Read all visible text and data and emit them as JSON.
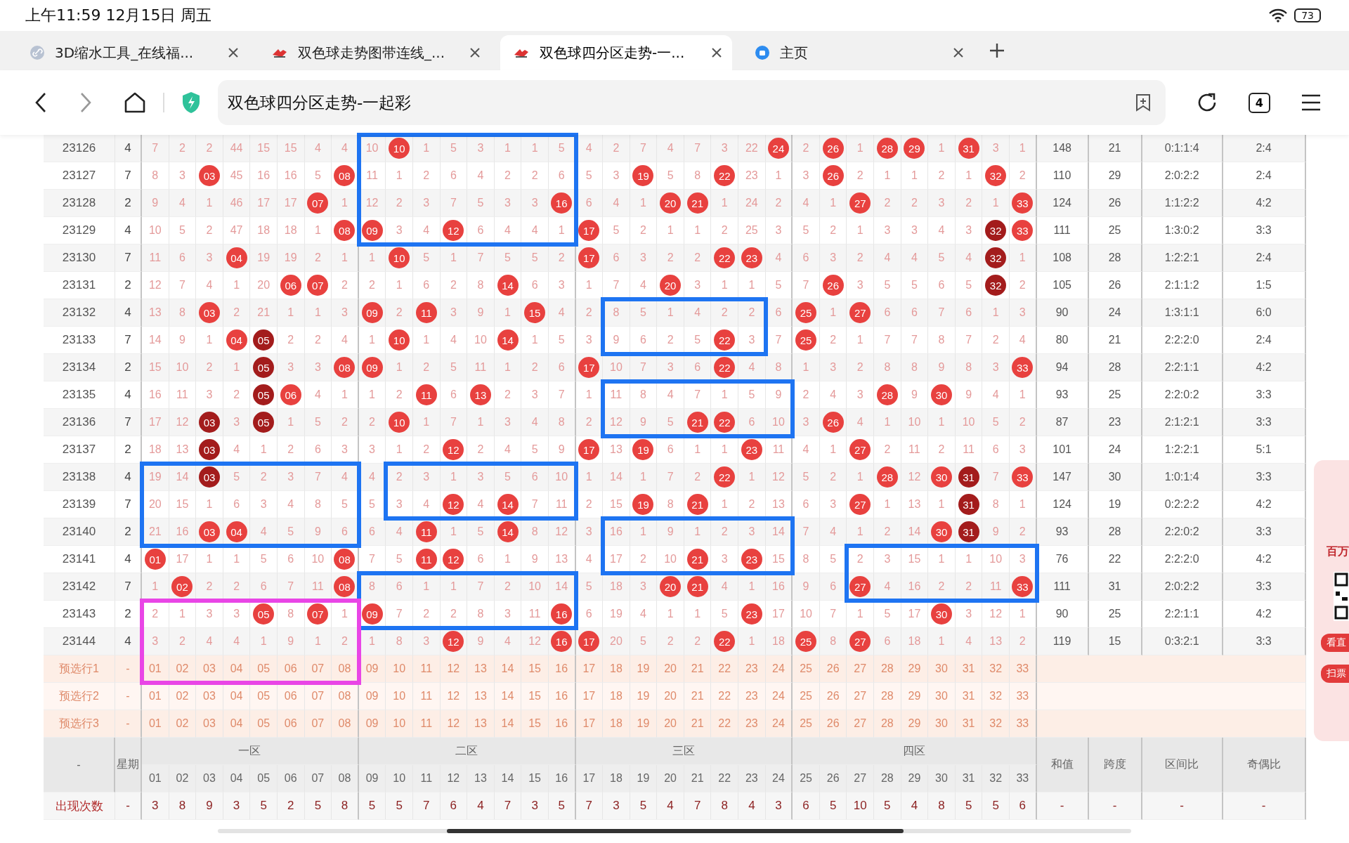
{
  "status_bar": {
    "time": "上午11:59 12月15日 周五",
    "battery": "73"
  },
  "tabs": [
    {
      "title": "3D缩水工具_在线福...",
      "kind": "link",
      "selected": false
    },
    {
      "title": "双色球走势图带连线_...",
      "kind": "site",
      "selected": false
    },
    {
      "title": "双色球四分区走势-一...",
      "kind": "site",
      "selected": true
    },
    {
      "title": "主页",
      "kind": "home",
      "selected": false
    }
  ],
  "address_bar": {
    "value": "双色球四分区走势-一起彩",
    "tab_count": "4"
  },
  "rows": [
    {
      "period": "23126",
      "weekday": "4",
      "cells": [
        "7",
        "2",
        "2",
        "44",
        "15",
        "15",
        "4",
        "4",
        "10",
        {
          "ball": "10",
          "kind": "red"
        },
        "1",
        "5",
        "3",
        "1",
        "1",
        "5",
        "4",
        "2",
        "7",
        "4",
        "7",
        "3",
        "22",
        {
          "ball": "24",
          "kind": "red"
        },
        "2",
        {
          "ball": "26",
          "kind": "red"
        },
        "1",
        {
          "ball": "28",
          "kind": "red"
        },
        {
          "ball": "29",
          "kind": "red"
        },
        "1",
        {
          "ball": "31",
          "kind": "red"
        },
        "3",
        "1"
      ],
      "sum": "148",
      "span": "21",
      "zone_ratio": "0:1:1:4",
      "odd_even": "2:4"
    },
    {
      "period": "23127",
      "weekday": "7",
      "cells": [
        "8",
        "3",
        {
          "ball": "03",
          "kind": "red"
        },
        "45",
        "16",
        "16",
        "5",
        {
          "ball": "08",
          "kind": "red"
        },
        "11",
        "1",
        "2",
        "6",
        "4",
        "2",
        "2",
        "6",
        "5",
        "3",
        {
          "ball": "19",
          "kind": "red"
        },
        "5",
        "8",
        {
          "ball": "22",
          "kind": "red"
        },
        "23",
        "1",
        "3",
        {
          "ball": "26",
          "kind": "red"
        },
        "2",
        "1",
        "1",
        "2",
        "1",
        {
          "ball": "32",
          "kind": "red"
        },
        "2"
      ],
      "sum": "110",
      "span": "29",
      "zone_ratio": "2:0:2:2",
      "odd_even": "2:4"
    },
    {
      "period": "23128",
      "weekday": "2",
      "cells": [
        "9",
        "4",
        "1",
        "46",
        "17",
        "17",
        {
          "ball": "07",
          "kind": "red"
        },
        "1",
        "12",
        "2",
        "3",
        "7",
        "5",
        "3",
        "3",
        {
          "ball": "16",
          "kind": "red"
        },
        "6",
        "4",
        "1",
        {
          "ball": "20",
          "kind": "red"
        },
        {
          "ball": "21",
          "kind": "red"
        },
        "1",
        "24",
        "2",
        "4",
        "1",
        {
          "ball": "27",
          "kind": "red"
        },
        "2",
        "2",
        "3",
        "2",
        "1",
        {
          "ball": "33",
          "kind": "red"
        }
      ],
      "sum": "124",
      "span": "26",
      "zone_ratio": "1:1:2:2",
      "odd_even": "4:2"
    },
    {
      "period": "23129",
      "weekday": "4",
      "cells": [
        "10",
        "5",
        "2",
        "47",
        "18",
        "18",
        "1",
        {
          "ball": "08",
          "kind": "red"
        },
        {
          "ball": "09",
          "kind": "red"
        },
        "3",
        "4",
        {
          "ball": "12",
          "kind": "red"
        },
        "6",
        "4",
        "4",
        "1",
        {
          "ball": "17",
          "kind": "red"
        },
        "5",
        "2",
        "1",
        "1",
        "2",
        "25",
        "3",
        "5",
        "2",
        "1",
        "3",
        "3",
        "4",
        "3",
        {
          "ball": "32",
          "kind": "dark"
        },
        {
          "ball": "33",
          "kind": "red"
        }
      ],
      "sum": "111",
      "span": "25",
      "zone_ratio": "1:3:0:2",
      "odd_even": "3:3"
    },
    {
      "period": "23130",
      "weekday": "7",
      "cells": [
        "11",
        "6",
        "3",
        {
          "ball": "04",
          "kind": "red"
        },
        "19",
        "19",
        "2",
        "1",
        "1",
        {
          "ball": "10",
          "kind": "red"
        },
        "5",
        "1",
        "7",
        "5",
        "5",
        "2",
        {
          "ball": "17",
          "kind": "red"
        },
        "6",
        "3",
        "2",
        "2",
        {
          "ball": "22",
          "kind": "red"
        },
        {
          "ball": "23",
          "kind": "red"
        },
        "4",
        "6",
        "3",
        "2",
        "4",
        "4",
        "5",
        "4",
        {
          "ball": "32",
          "kind": "dark"
        },
        "1"
      ],
      "sum": "108",
      "span": "28",
      "zone_ratio": "1:2:2:1",
      "odd_even": "2:4"
    },
    {
      "period": "23131",
      "weekday": "2",
      "cells": [
        "12",
        "7",
        "4",
        "1",
        "20",
        {
          "ball": "06",
          "kind": "red"
        },
        {
          "ball": "07",
          "kind": "red"
        },
        "2",
        "2",
        "1",
        "6",
        "2",
        "8",
        {
          "ball": "14",
          "kind": "red"
        },
        "6",
        "3",
        "1",
        "7",
        "4",
        {
          "ball": "20",
          "kind": "red"
        },
        "3",
        "1",
        "1",
        "5",
        "7",
        {
          "ball": "26",
          "kind": "red"
        },
        "3",
        "5",
        "5",
        "6",
        "5",
        {
          "ball": "32",
          "kind": "dark"
        },
        "2"
      ],
      "sum": "105",
      "span": "26",
      "zone_ratio": "2:1:1:2",
      "odd_even": "1:5"
    },
    {
      "period": "23132",
      "weekday": "4",
      "cells": [
        "13",
        "8",
        {
          "ball": "03",
          "kind": "red"
        },
        "2",
        "21",
        "1",
        "1",
        "3",
        {
          "ball": "09",
          "kind": "red"
        },
        "2",
        {
          "ball": "11",
          "kind": "red"
        },
        "3",
        "9",
        "1",
        {
          "ball": "15",
          "kind": "red"
        },
        "4",
        "2",
        "8",
        "5",
        "1",
        "4",
        "2",
        "2",
        "6",
        {
          "ball": "25",
          "kind": "red"
        },
        "1",
        {
          "ball": "27",
          "kind": "red"
        },
        "6",
        "6",
        "7",
        "6",
        "1",
        "3"
      ],
      "sum": "90",
      "span": "24",
      "zone_ratio": "1:3:1:1",
      "odd_even": "6:0"
    },
    {
      "period": "23133",
      "weekday": "7",
      "cells": [
        "14",
        "9",
        "1",
        {
          "ball": "04",
          "kind": "red"
        },
        {
          "ball": "05",
          "kind": "dark"
        },
        "2",
        "2",
        "4",
        "1",
        {
          "ball": "10",
          "kind": "red"
        },
        "1",
        "4",
        "10",
        {
          "ball": "14",
          "kind": "red"
        },
        "1",
        "5",
        "3",
        "9",
        "6",
        "2",
        "5",
        {
          "ball": "22",
          "kind": "red"
        },
        "3",
        "7",
        {
          "ball": "25",
          "kind": "red"
        },
        "2",
        "1",
        "7",
        "7",
        "8",
        "7",
        "2",
        "4"
      ],
      "sum": "80",
      "span": "21",
      "zone_ratio": "2:2:2:0",
      "odd_even": "2:4"
    },
    {
      "period": "23134",
      "weekday": "2",
      "cells": [
        "15",
        "10",
        "2",
        "1",
        {
          "ball": "05",
          "kind": "dark"
        },
        "3",
        "3",
        {
          "ball": "08",
          "kind": "red"
        },
        {
          "ball": "09",
          "kind": "red"
        },
        "1",
        "2",
        "5",
        "11",
        "1",
        "2",
        "6",
        {
          "ball": "17",
          "kind": "red"
        },
        "10",
        "7",
        "3",
        "6",
        {
          "ball": "22",
          "kind": "red"
        },
        "4",
        "8",
        "1",
        "3",
        "2",
        "8",
        "8",
        "9",
        "8",
        "3",
        {
          "ball": "33",
          "kind": "red"
        }
      ],
      "sum": "94",
      "span": "28",
      "zone_ratio": "2:2:1:1",
      "odd_even": "4:2"
    },
    {
      "period": "23135",
      "weekday": "4",
      "cells": [
        "16",
        "11",
        "3",
        "2",
        {
          "ball": "05",
          "kind": "dark"
        },
        {
          "ball": "06",
          "kind": "red"
        },
        "4",
        "1",
        "1",
        "2",
        {
          "ball": "11",
          "kind": "red"
        },
        "6",
        {
          "ball": "13",
          "kind": "red"
        },
        "2",
        "3",
        "7",
        "1",
        "11",
        "8",
        "4",
        "7",
        "1",
        "5",
        "9",
        "2",
        "4",
        "3",
        {
          "ball": "28",
          "kind": "red"
        },
        "9",
        {
          "ball": "30",
          "kind": "red"
        },
        "9",
        "4",
        "1"
      ],
      "sum": "93",
      "span": "25",
      "zone_ratio": "2:2:0:2",
      "odd_even": "3:3"
    },
    {
      "period": "23136",
      "weekday": "7",
      "cells": [
        "17",
        "12",
        {
          "ball": "03",
          "kind": "dark"
        },
        "3",
        {
          "ball": "05",
          "kind": "dark"
        },
        "1",
        "5",
        "2",
        "2",
        {
          "ball": "10",
          "kind": "red"
        },
        "1",
        "7",
        "1",
        "3",
        "4",
        "8",
        "2",
        "12",
        "9",
        "5",
        {
          "ball": "21",
          "kind": "red"
        },
        {
          "ball": "22",
          "kind": "red"
        },
        "6",
        "10",
        "3",
        {
          "ball": "26",
          "kind": "red"
        },
        "4",
        "1",
        "10",
        "1",
        "10",
        "5",
        "2"
      ],
      "sum": "87",
      "span": "23",
      "zone_ratio": "2:1:2:1",
      "odd_even": "3:3"
    },
    {
      "period": "23137",
      "weekday": "2",
      "cells": [
        "18",
        "13",
        {
          "ball": "03",
          "kind": "dark"
        },
        "4",
        "1",
        "2",
        "6",
        "3",
        "3",
        "1",
        "2",
        {
          "ball": "12",
          "kind": "red"
        },
        "2",
        "4",
        "5",
        "9",
        {
          "ball": "17",
          "kind": "red"
        },
        "13",
        {
          "ball": "19",
          "kind": "red"
        },
        "6",
        "1",
        "1",
        {
          "ball": "23",
          "kind": "red"
        },
        "11",
        "4",
        "1",
        {
          "ball": "27",
          "kind": "red"
        },
        "2",
        "11",
        "2",
        "11",
        "6",
        "3"
      ],
      "sum": "101",
      "span": "24",
      "zone_ratio": "1:2:2:1",
      "odd_even": "5:1"
    },
    {
      "period": "23138",
      "weekday": "4",
      "cells": [
        "19",
        "14",
        {
          "ball": "03",
          "kind": "dark"
        },
        "5",
        "2",
        "3",
        "7",
        "4",
        "4",
        "2",
        "3",
        "1",
        "3",
        "5",
        "6",
        "10",
        "1",
        "14",
        "1",
        "7",
        "2",
        {
          "ball": "22",
          "kind": "red"
        },
        "1",
        "12",
        "5",
        "2",
        "1",
        {
          "ball": "28",
          "kind": "red"
        },
        "12",
        {
          "ball": "30",
          "kind": "red"
        },
        {
          "ball": "31",
          "kind": "dark"
        },
        "7",
        {
          "ball": "33",
          "kind": "red"
        }
      ],
      "sum": "147",
      "span": "30",
      "zone_ratio": "1:0:1:4",
      "odd_even": "3:3"
    },
    {
      "period": "23139",
      "weekday": "7",
      "cells": [
        "20",
        "15",
        "1",
        "6",
        "3",
        "4",
        "8",
        "5",
        "5",
        "3",
        "4",
        {
          "ball": "12",
          "kind": "red"
        },
        "4",
        {
          "ball": "14",
          "kind": "red"
        },
        "7",
        "11",
        "2",
        "15",
        {
          "ball": "19",
          "kind": "red"
        },
        "8",
        {
          "ball": "21",
          "kind": "red"
        },
        "1",
        "2",
        "13",
        "6",
        "3",
        {
          "ball": "27",
          "kind": "red"
        },
        "1",
        "13",
        "1",
        {
          "ball": "31",
          "kind": "dark"
        },
        "8",
        "1"
      ],
      "sum": "124",
      "span": "19",
      "zone_ratio": "0:2:2:2",
      "odd_even": "4:2"
    },
    {
      "period": "23140",
      "weekday": "2",
      "cells": [
        "21",
        "16",
        {
          "ball": "03",
          "kind": "red"
        },
        {
          "ball": "04",
          "kind": "red"
        },
        "4",
        "5",
        "9",
        "6",
        "6",
        "4",
        {
          "ball": "11",
          "kind": "red"
        },
        "1",
        "5",
        {
          "ball": "14",
          "kind": "red"
        },
        "8",
        "12",
        "3",
        "16",
        "1",
        "9",
        "1",
        "2",
        "3",
        "14",
        "7",
        "4",
        "1",
        "2",
        "14",
        {
          "ball": "30",
          "kind": "red"
        },
        {
          "ball": "31",
          "kind": "dark"
        },
        "9",
        "2"
      ],
      "sum": "93",
      "span": "28",
      "zone_ratio": "2:2:0:2",
      "odd_even": "3:3"
    },
    {
      "period": "23141",
      "weekday": "4",
      "cells": [
        {
          "ball": "01",
          "kind": "red"
        },
        "17",
        "1",
        "1",
        "5",
        "6",
        "10",
        {
          "ball": "08",
          "kind": "red"
        },
        "7",
        "5",
        {
          "ball": "11",
          "kind": "red"
        },
        {
          "ball": "12",
          "kind": "red"
        },
        "6",
        "1",
        "9",
        "13",
        "4",
        "17",
        "2",
        "10",
        {
          "ball": "21",
          "kind": "red"
        },
        "3",
        {
          "ball": "23",
          "kind": "red"
        },
        "15",
        "8",
        "5",
        "2",
        "3",
        "15",
        "1",
        "1",
        "10",
        "3"
      ],
      "sum": "76",
      "span": "22",
      "zone_ratio": "2:2:2:0",
      "odd_even": "4:2"
    },
    {
      "period": "23142",
      "weekday": "7",
      "cells": [
        "1",
        {
          "ball": "02",
          "kind": "red"
        },
        "2",
        "2",
        "6",
        "7",
        "11",
        {
          "ball": "08",
          "kind": "red"
        },
        "8",
        "6",
        "1",
        "1",
        "7",
        "2",
        "10",
        "14",
        "5",
        "18",
        "3",
        {
          "ball": "20",
          "kind": "red"
        },
        {
          "ball": "21",
          "kind": "red"
        },
        "4",
        "1",
        "16",
        "9",
        "6",
        {
          "ball": "27",
          "kind": "red"
        },
        "4",
        "16",
        "2",
        "2",
        "11",
        {
          "ball": "33",
          "kind": "red"
        }
      ],
      "sum": "111",
      "span": "31",
      "zone_ratio": "2:0:2:2",
      "odd_even": "3:3"
    },
    {
      "period": "23143",
      "weekday": "2",
      "cells": [
        "2",
        "1",
        "3",
        "3",
        {
          "ball": "05",
          "kind": "red"
        },
        "8",
        {
          "ball": "07",
          "kind": "red"
        },
        "1",
        {
          "ball": "09",
          "kind": "red"
        },
        "7",
        "2",
        "2",
        "8",
        "3",
        "11",
        {
          "ball": "16",
          "kind": "red"
        },
        "6",
        "19",
        "4",
        "1",
        "1",
        "5",
        {
          "ball": "23",
          "kind": "red"
        },
        "17",
        "10",
        "7",
        "1",
        "5",
        "17",
        {
          "ball": "30",
          "kind": "red"
        },
        "3",
        "12",
        "1"
      ],
      "sum": "90",
      "span": "25",
      "zone_ratio": "2:2:1:1",
      "odd_even": "4:2"
    },
    {
      "period": "23144",
      "weekday": "4",
      "cells": [
        "3",
        "2",
        "4",
        "4",
        "1",
        "9",
        "1",
        "2",
        "1",
        "8",
        "3",
        {
          "ball": "12",
          "kind": "red"
        },
        "9",
        "4",
        "12",
        {
          "ball": "16",
          "kind": "red"
        },
        {
          "ball": "17",
          "kind": "red"
        },
        "20",
        "5",
        "2",
        "2",
        {
          "ball": "22",
          "kind": "red"
        },
        "1",
        "18",
        {
          "ball": "25",
          "kind": "red"
        },
        "8",
        {
          "ball": "27",
          "kind": "red"
        },
        "6",
        "18",
        "1",
        "4",
        "13",
        "2"
      ],
      "sum": "119",
      "span": "15",
      "zone_ratio": "0:3:2:1",
      "odd_even": "3:3"
    }
  ],
  "preselect_rows": [
    {
      "label": "预选行1",
      "weekday": "-",
      "numbers": [
        "01",
        "02",
        "03",
        "04",
        "05",
        "06",
        "07",
        "08",
        "09",
        "10",
        "11",
        "12",
        "13",
        "14",
        "15",
        "16",
        "17",
        "18",
        "19",
        "20",
        "21",
        "22",
        "23",
        "24",
        "25",
        "26",
        "27",
        "28",
        "29",
        "30",
        "31",
        "32",
        "33"
      ]
    },
    {
      "label": "预选行2",
      "weekday": "-",
      "numbers": [
        "01",
        "02",
        "03",
        "04",
        "05",
        "06",
        "07",
        "08",
        "09",
        "10",
        "11",
        "12",
        "13",
        "14",
        "15",
        "16",
        "17",
        "18",
        "19",
        "20",
        "21",
        "22",
        "23",
        "24",
        "25",
        "26",
        "27",
        "28",
        "29",
        "30",
        "31",
        "32",
        "33"
      ]
    },
    {
      "label": "预选行3",
      "weekday": "-",
      "numbers": [
        "01",
        "02",
        "03",
        "04",
        "05",
        "06",
        "07",
        "08",
        "09",
        "10",
        "11",
        "12",
        "13",
        "14",
        "15",
        "16",
        "17",
        "18",
        "19",
        "20",
        "21",
        "22",
        "23",
        "24",
        "25",
        "26",
        "27",
        "28",
        "29",
        "30",
        "31",
        "32",
        "33"
      ]
    }
  ],
  "header": {
    "corner": "-",
    "weekday": "星期",
    "zones": [
      {
        "name": "一区",
        "numbers": [
          "01",
          "02",
          "03",
          "04",
          "05",
          "06",
          "07",
          "08"
        ]
      },
      {
        "name": "二区",
        "numbers": [
          "09",
          "10",
          "11",
          "12",
          "13",
          "14",
          "15",
          "16"
        ]
      },
      {
        "name": "三区",
        "numbers": [
          "17",
          "18",
          "19",
          "20",
          "21",
          "22",
          "23",
          "24"
        ]
      },
      {
        "name": "四区",
        "numbers": [
          "25",
          "26",
          "27",
          "28",
          "29",
          "30",
          "31",
          "32",
          "33"
        ]
      }
    ],
    "stats": [
      "和值",
      "跨度",
      "区间比",
      "奇偶比"
    ]
  },
  "counts_row": {
    "label": "出现次数",
    "weekday": "-",
    "counts": [
      "3",
      "8",
      "9",
      "3",
      "5",
      "2",
      "5",
      "8",
      "5",
      "5",
      "7",
      "6",
      "4",
      "7",
      "3",
      "5",
      "7",
      "3",
      "5",
      "4",
      "7",
      "8",
      "4",
      "3",
      "6",
      "5",
      "10",
      "5",
      "4",
      "8",
      "5",
      "5",
      "6"
    ],
    "stats": [
      "-",
      "-",
      "-",
      "-"
    ]
  },
  "side_ad": {
    "title": "百万",
    "buttons": [
      "看直",
      "扫票"
    ]
  }
}
